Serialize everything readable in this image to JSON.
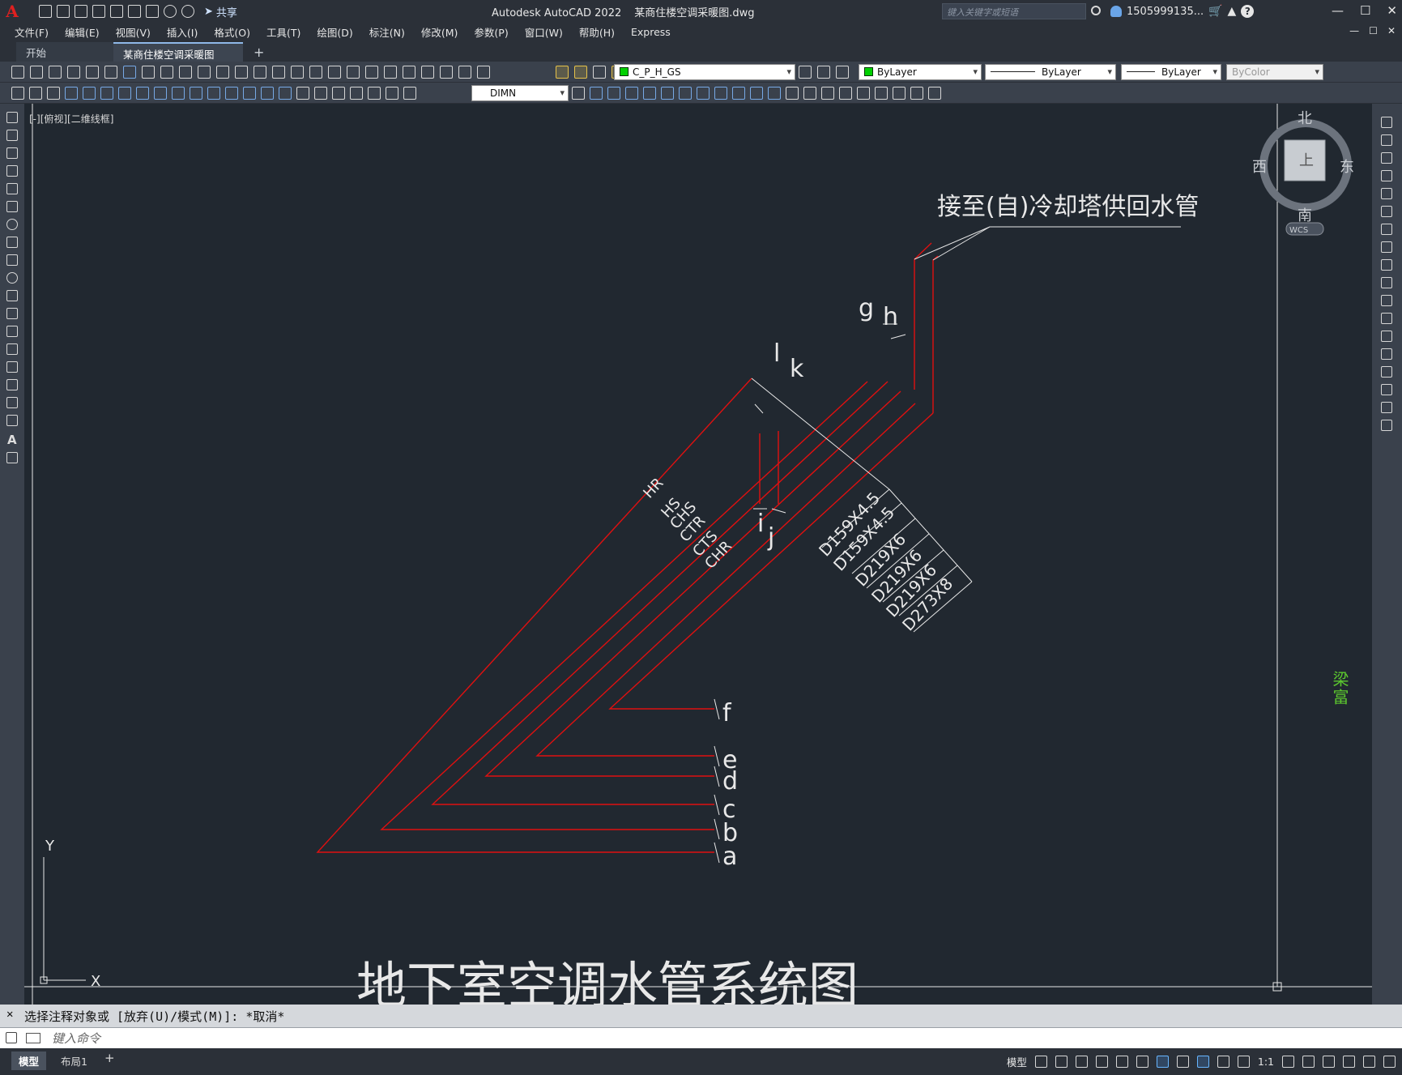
{
  "app": {
    "logo": "A",
    "title": "Autodesk AutoCAD 2022",
    "filename": "某商住楼空调采暖图.dwg",
    "share": "共享",
    "search_placeholder": "键入关键字或短语",
    "user": "1505999135...",
    "help": "?"
  },
  "window_controls": [
    "—",
    "☐",
    "✕"
  ],
  "menu": [
    "文件(F)",
    "编辑(E)",
    "视图(V)",
    "插入(I)",
    "格式(O)",
    "工具(T)",
    "绘图(D)",
    "标注(N)",
    "修改(M)",
    "参数(P)",
    "窗口(W)",
    "帮助(H)",
    "Express"
  ],
  "tabs": {
    "start": "开始",
    "active": "某商住楼空调采暖图*",
    "close": "✕",
    "add": "+"
  },
  "toolbar1": {
    "layer": "C_P_H_GS",
    "color": "ByLayer",
    "linetype": "ByLayer",
    "lineweight": "ByLayer",
    "plotstyle": "ByColor"
  },
  "toolbar2": {
    "dimstyle": "DIMN"
  },
  "viewport": {
    "label": "[-][俯视][二维线框]",
    "viewcube": {
      "north": "北",
      "south": "南",
      "east": "东",
      "west": "西",
      "top": "上",
      "wcs": "WCS"
    },
    "side_text": "梁富"
  },
  "drawing": {
    "title": "地下室空调水管系统图",
    "callout": "接至(自)冷却塔供回水管",
    "pipe_labels": [
      "HR",
      "HS",
      "CHS",
      "CTR",
      "CTS",
      "CHR"
    ],
    "sizes": [
      "D159X4.5",
      "D159X4.5",
      "D219X6",
      "D219X6",
      "D219X6",
      "D273X8"
    ],
    "letters": [
      "a",
      "b",
      "c",
      "d",
      "e",
      "f",
      "g",
      "h",
      "i",
      "j",
      "k",
      "l"
    ],
    "ucs_x": "X",
    "ucs_y": "Y",
    "pipe_color": "#e01010"
  },
  "command": {
    "history": "选择注释对象或 [放弃(U)/模式(M)]: *取消*",
    "placeholder": "键入命令"
  },
  "status": {
    "model_tab": "模型",
    "layout_tab": "布局1",
    "add": "+",
    "mode": "模型",
    "scale": "1:1"
  }
}
